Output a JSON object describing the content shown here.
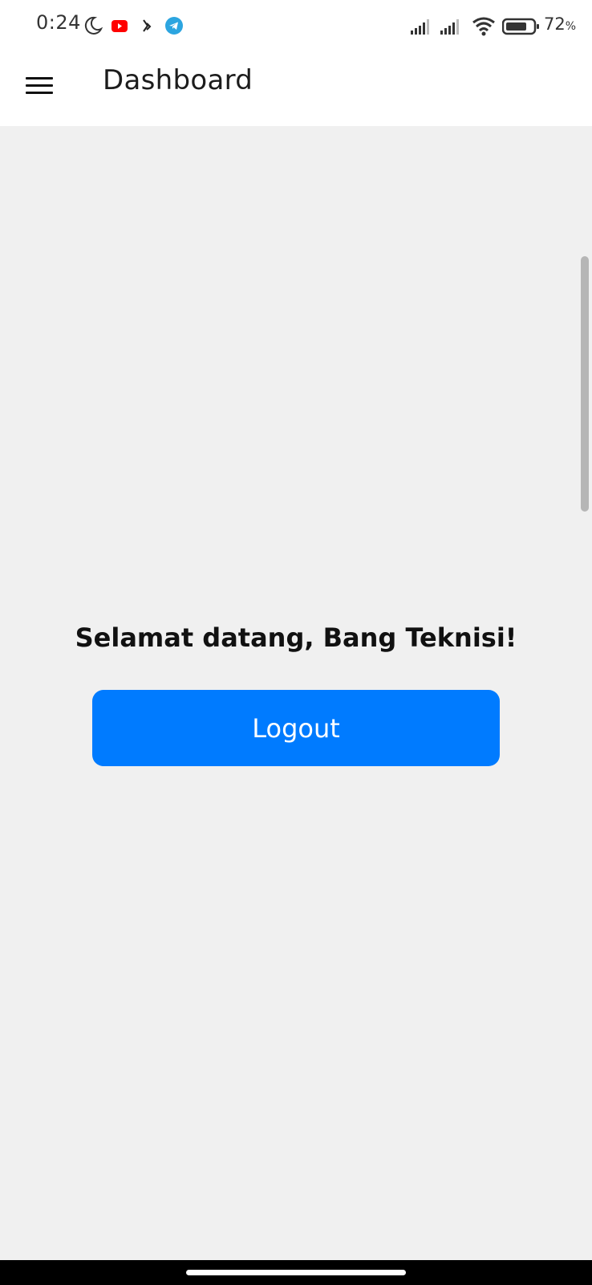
{
  "status_bar": {
    "time": "0:24",
    "battery_percent": "72",
    "battery_percent_sign": "%",
    "icons": [
      "moon-icon",
      "youtube-icon",
      "app-icon",
      "telegram-icon",
      "signal-icon",
      "signal-icon",
      "wifi-icon",
      "battery-icon"
    ],
    "colors": {
      "youtube": "#ff0000",
      "telegram": "#2ca5e0"
    }
  },
  "app_bar": {
    "title": "Dashboard",
    "menu_icon": "hamburger-menu-icon"
  },
  "main": {
    "welcome": "Selamat datang, Bang Teknisi!",
    "logout_label": "Logout"
  },
  "colors": {
    "accent": "#007bff",
    "background": "#f0f0f0",
    "app_bar": "#ffffff"
  }
}
